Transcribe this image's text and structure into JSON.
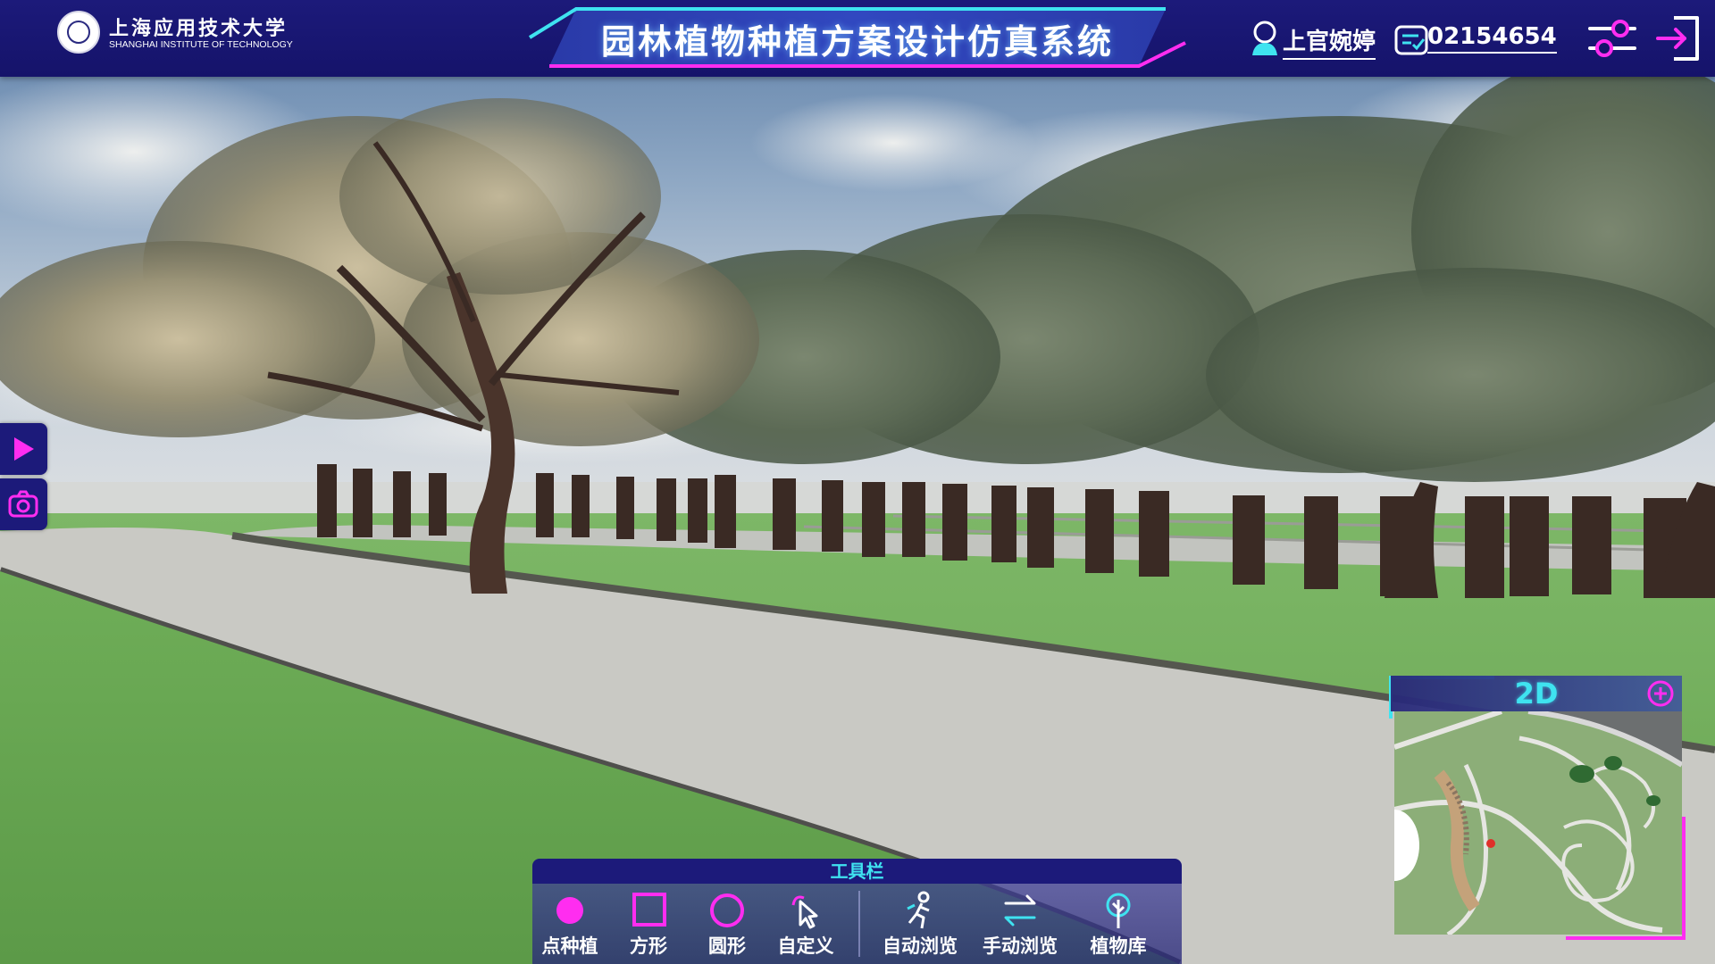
{
  "header": {
    "school_name_cn": "上海应用技术大学",
    "school_name_en": "SHANGHAI INSTITUTE OF TECHNOLOGY",
    "title": "园林植物种植方案设计仿真系统",
    "user_name": "上官婉婷",
    "user_id": "02154654",
    "icons": {
      "user": "user-icon",
      "id_card": "id-card-icon",
      "settings": "settings-sliders-icon",
      "logout": "logout-icon"
    }
  },
  "side_controls": {
    "play_icon": "play-icon",
    "camera_icon": "camera-icon"
  },
  "minimap": {
    "mode_label": "2D",
    "add_icon": "plus-circle-icon"
  },
  "toolbar": {
    "title": "工具栏",
    "tools": [
      {
        "label": "点种植",
        "icon": "dot-plant-icon"
      },
      {
        "label": "方形",
        "icon": "square-icon"
      },
      {
        "label": "圆形",
        "icon": "circle-icon"
      },
      {
        "label": "自定义",
        "icon": "custom-cursor-icon"
      },
      {
        "label": "自动浏览",
        "icon": "walking-person-icon"
      },
      {
        "label": "手动浏览",
        "icon": "swap-arrows-icon"
      },
      {
        "label": "植物库",
        "icon": "plant-library-icon"
      }
    ]
  },
  "colors": {
    "header_bg": "#1c1a7a",
    "accent_magenta": "#ff2df0",
    "accent_cyan": "#3fe3f0",
    "grass": "#6fae58",
    "path": "#c9c9c4"
  }
}
